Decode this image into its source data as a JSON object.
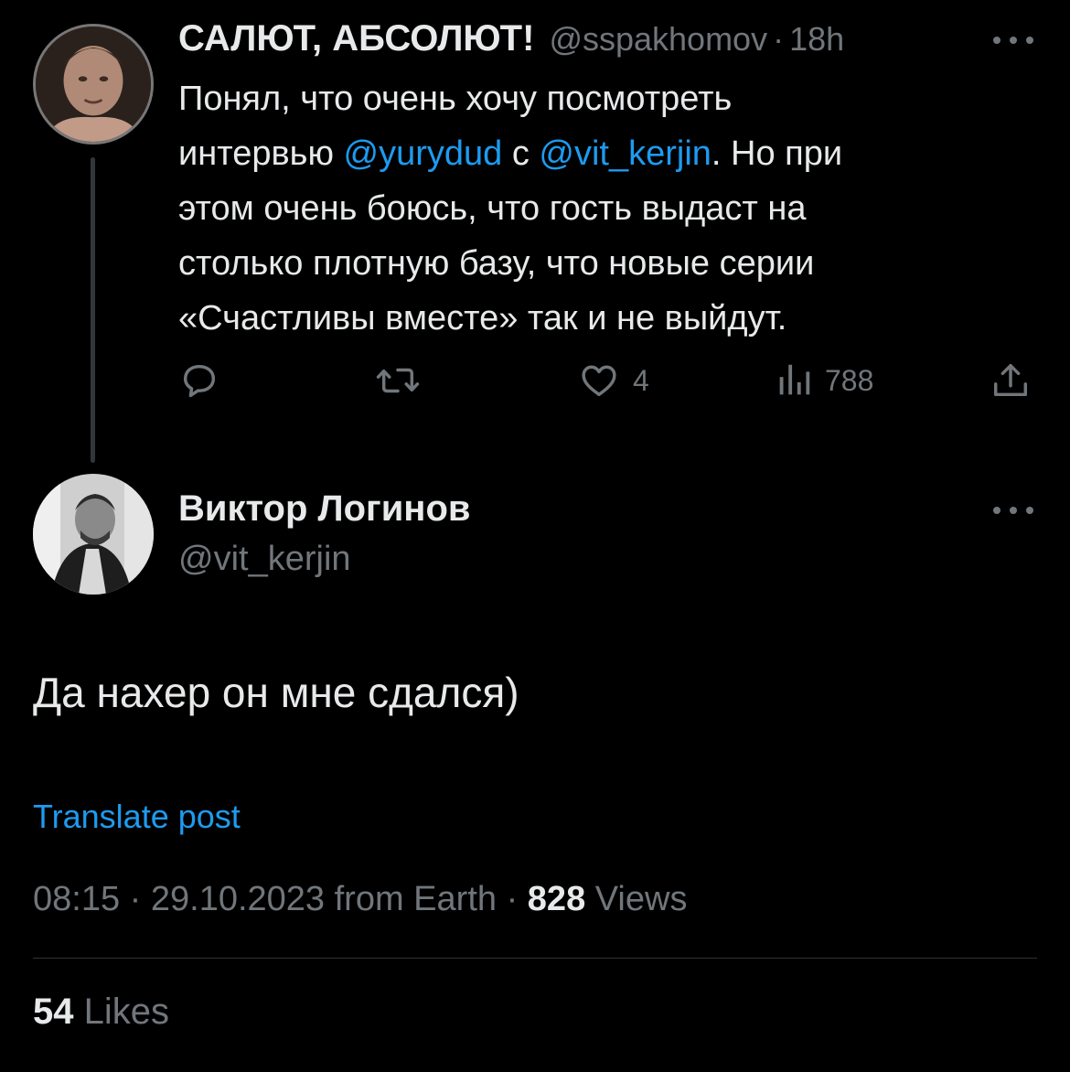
{
  "parent_tweet": {
    "author_name": "САЛЮТ, АБСОЛЮТ!",
    "author_handle": "@sspakhomov",
    "separator": "·",
    "time_ago": "18h",
    "text_lines": [
      [
        {
          "t": "Понял, что очень хочу посмотреть",
          "m": false
        }
      ],
      [
        {
          "t": "интервью ",
          "m": false
        },
        {
          "t": "@yurydud",
          "m": true
        },
        {
          "t": " с ",
          "m": false
        },
        {
          "t": "@vit_kerjin",
          "m": true
        },
        {
          "t": ". Но при",
          "m": false
        }
      ],
      [
        {
          "t": "этом очень боюсь, что гость выдаст на",
          "m": false
        }
      ],
      [
        {
          "t": "столько плотную базу, что новые серии",
          "m": false
        }
      ],
      [
        {
          "t": "«Счастливы вместе» так и не выйдут.",
          "m": false
        }
      ]
    ],
    "actions": {
      "reply": {
        "icon": "reply-icon",
        "count": ""
      },
      "retweet": {
        "icon": "retweet-icon",
        "count": ""
      },
      "like": {
        "icon": "heart-icon",
        "count": "4"
      },
      "views": {
        "icon": "views-icon",
        "count": "788"
      },
      "share": {
        "icon": "share-icon"
      }
    }
  },
  "focused_tweet": {
    "author_name": "Виктор Логинов",
    "author_handle": "@vit_kerjin",
    "text": "Да нахер он мне сдался)",
    "translate_label": "Translate post",
    "time": "08:15",
    "sep": "·",
    "date": "29.10.2023",
    "source": "from Earth",
    "views_count": "828",
    "views_label": "Views",
    "likes_count": "54",
    "likes_label": "Likes"
  },
  "colors": {
    "background": "#000000",
    "text_primary": "#e7e9ea",
    "text_secondary": "#71767b",
    "accent": "#1d9bf0",
    "divider": "#2f3336"
  }
}
